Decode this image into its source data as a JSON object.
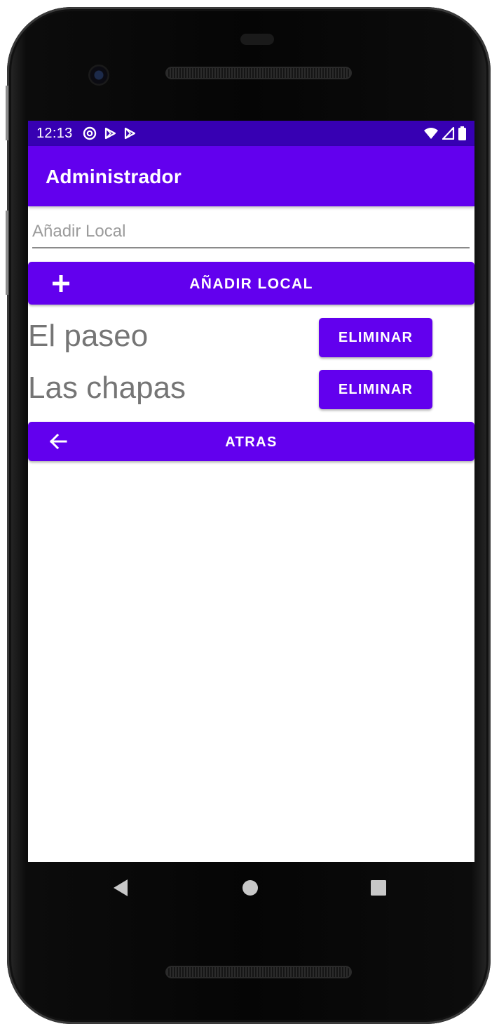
{
  "status_bar": {
    "time": "12:13",
    "left_icons": [
      "sync-icon",
      "play-store-icon",
      "play-store-icon"
    ],
    "right_icons": [
      "wifi-icon",
      "cell-signal-icon",
      "battery-icon"
    ]
  },
  "app_bar": {
    "title": "Administrador"
  },
  "add_input": {
    "placeholder": "Añadir Local",
    "value": ""
  },
  "add_button": {
    "label": "AÑADIR LOCAL",
    "icon": "plus-icon"
  },
  "locals": [
    {
      "name": "El paseo",
      "delete_label": "ELIMINAR"
    },
    {
      "name": "Las chapas",
      "delete_label": "ELIMINAR"
    }
  ],
  "back_button": {
    "label": "ATRAS",
    "icon": "arrow-back-icon"
  },
  "nav": [
    "back-icon",
    "home-icon",
    "recents-icon"
  ],
  "colors": {
    "primary": "#6200ee",
    "primary_dark": "#3700b3",
    "text_secondary": "#757575"
  }
}
